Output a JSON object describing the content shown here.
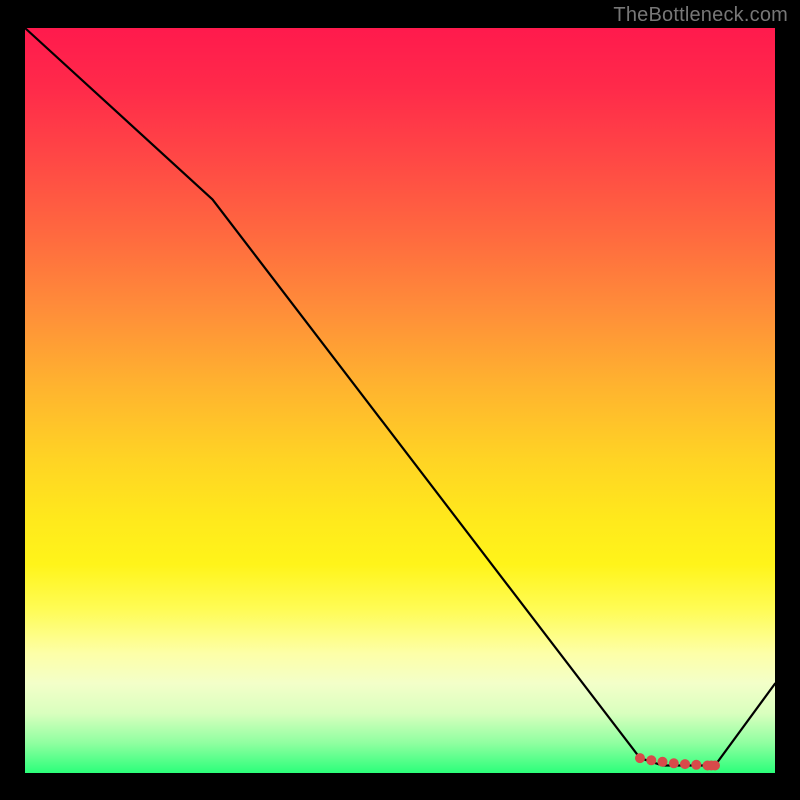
{
  "watermark": "TheBottleneck.com",
  "chart_data": {
    "type": "line",
    "title": "",
    "xlabel": "",
    "ylabel": "",
    "xlim": [
      0,
      100
    ],
    "ylim": [
      0,
      100
    ],
    "series": [
      {
        "name": "curve",
        "x": [
          0,
          25,
          82,
          85,
          88,
          92,
          100
        ],
        "values": [
          100,
          77,
          2,
          1,
          1,
          1,
          12
        ]
      }
    ],
    "markers": {
      "x": [
        82,
        83.5,
        85,
        86.5,
        88,
        89.5,
        91,
        91.5,
        92
      ],
      "values": [
        2,
        1.7,
        1.5,
        1.3,
        1.2,
        1.1,
        1,
        1,
        1
      ],
      "color": "#d84a4a"
    },
    "gradient_stops": [
      {
        "pos": 0,
        "color": "#ff1a4d"
      },
      {
        "pos": 18,
        "color": "#ff4945"
      },
      {
        "pos": 38,
        "color": "#ff8e39"
      },
      {
        "pos": 58,
        "color": "#ffd424"
      },
      {
        "pos": 78,
        "color": "#fffc55"
      },
      {
        "pos": 92,
        "color": "#d9ffbe"
      },
      {
        "pos": 100,
        "color": "#2bff7a"
      }
    ]
  }
}
